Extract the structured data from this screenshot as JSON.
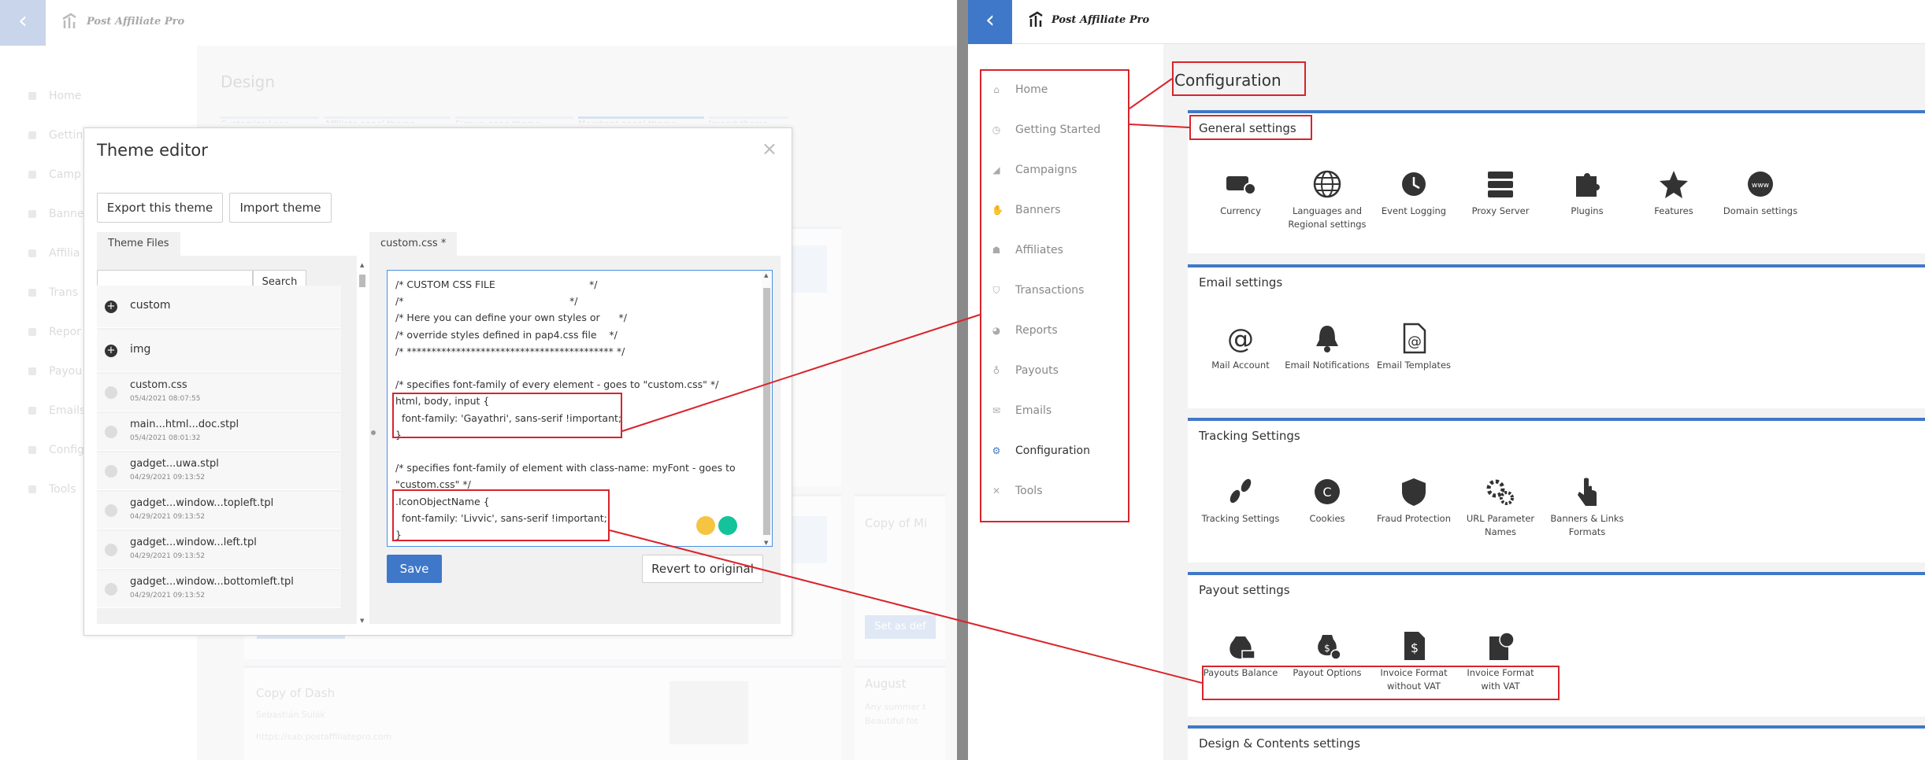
{
  "app": {
    "brand": "Post Affiliate Pro"
  },
  "left_screen": {
    "nav": [
      "Home",
      "Gettin",
      "Camp",
      "Banne",
      "Affilia",
      "Trans",
      "Repor",
      "Payou",
      "Emails",
      "Config",
      "Tools"
    ],
    "page_title": "Design",
    "tabs": [
      "Customize Logo",
      "Affiliate panel theme",
      "Signup page theme",
      "Merchant panel theme",
      "Import theme"
    ],
    "ghost": {
      "copy_of_dash": "Copy of Dash",
      "author": "Sebastián Sulák",
      "url": "https://sab.postaffiliatepro.com",
      "copy_of_mi": "Copy of Mi",
      "august": "August",
      "august_sub1": "Any summer t",
      "august_sub2": "Beautiful fot",
      "set_as_default": "Set as def"
    }
  },
  "theme_editor": {
    "title": "Theme editor",
    "close": "×",
    "export_button": "Export this theme",
    "import_button": "Import theme",
    "files_tab": "Theme Files",
    "editor_tab": "custom.css *",
    "search_button": "Search",
    "search_value": "",
    "folders": [
      "custom",
      "img"
    ],
    "files": [
      {
        "name": "custom.css",
        "date": "05/4/2021 08:07:55"
      },
      {
        "name": "main...html...doc.stpl",
        "date": "05/4/2021 08:01:32"
      },
      {
        "name": "gadget...uwa.stpl",
        "date": "04/29/2021 09:13:52"
      },
      {
        "name": "gadget...window...topleft.tpl",
        "date": "04/29/2021 09:13:52"
      },
      {
        "name": "gadget...window...left.tpl",
        "date": "04/29/2021 09:13:52"
      },
      {
        "name": "gadget...window...bottomleft.tpl",
        "date": "04/29/2021 09:13:52"
      }
    ],
    "code_lines": [
      "/* CUSTOM CSS FILE                              */",
      "/*                                                     */",
      "/* Here you can define your own styles or      */",
      "/* override styles defined in pap4.css file    */",
      "/* ****************************************** */",
      "",
      "/* specifies font-family of every element - goes to \"custom.css\" */",
      "html, body, input {",
      "  font-family: 'Gayathri', sans-serif !important;",
      "}",
      "",
      "/* specifies font-family of element with class-name: myFont - goes to",
      "\"custom.css\" */",
      ".IconObjectName {",
      "  font-family: 'Livvic', sans-serif !important;",
      "}"
    ],
    "save_button": "Save",
    "revert_button": "Revert to original"
  },
  "right_screen": {
    "nav": [
      {
        "label": "Home",
        "icon": "home-icon",
        "glyph": "⌂"
      },
      {
        "label": "Getting Started",
        "icon": "stopwatch-icon",
        "glyph": "◷"
      },
      {
        "label": "Campaigns",
        "icon": "megaphone-icon",
        "glyph": "◢"
      },
      {
        "label": "Banners",
        "icon": "hand-icon",
        "glyph": "✋"
      },
      {
        "label": "Affiliates",
        "icon": "users-icon",
        "glyph": "☗"
      },
      {
        "label": "Transactions",
        "icon": "basket-icon",
        "glyph": "⛉"
      },
      {
        "label": "Reports",
        "icon": "pie-chart-icon",
        "glyph": "◕"
      },
      {
        "label": "Payouts",
        "icon": "money-bag-icon",
        "glyph": "♁"
      },
      {
        "label": "Emails",
        "icon": "envelope-icon",
        "glyph": "✉"
      },
      {
        "label": "Configuration",
        "icon": "gear-icon",
        "glyph": "⚙"
      },
      {
        "label": "Tools",
        "icon": "tools-icon",
        "glyph": "✕"
      }
    ],
    "active_nav": "Configuration",
    "page_title": "Configuration",
    "sections": [
      {
        "title": "General settings",
        "items": [
          {
            "label": "Currency",
            "icon": "currency-icon"
          },
          {
            "label": "Languages and Regional settings",
            "icon": "globe-icon"
          },
          {
            "label": "Event Logging",
            "icon": "history-icon"
          },
          {
            "label": "Proxy Server",
            "icon": "server-icon"
          },
          {
            "label": "Plugins",
            "icon": "puzzle-icon"
          },
          {
            "label": "Features",
            "icon": "star-icon"
          },
          {
            "label": "Domain settings",
            "icon": "www-globe-icon"
          }
        ]
      },
      {
        "title": "Email settings",
        "items": [
          {
            "label": "Mail Account",
            "icon": "at-icon"
          },
          {
            "label": "Email Notifications",
            "icon": "bell-icon"
          },
          {
            "label": "Email Templates",
            "icon": "email-template-icon"
          }
        ]
      },
      {
        "title": "Tracking Settings",
        "items": [
          {
            "label": "Tracking Settings",
            "icon": "footprints-icon"
          },
          {
            "label": "Cookies",
            "icon": "cookie-icon"
          },
          {
            "label": "Fraud Protection",
            "icon": "shield-icon"
          },
          {
            "label": "URL Parameter Names",
            "icon": "gears-icon"
          },
          {
            "label": "Banners & Links Formats",
            "icon": "pointer-hand-icon"
          }
        ]
      },
      {
        "title": "Payout settings",
        "items": [
          {
            "label": "Payouts Balance",
            "icon": "balance-icon"
          },
          {
            "label": "Payout Options",
            "icon": "money-bag-gear-icon"
          },
          {
            "label": "Invoice Format without VAT",
            "icon": "invoice-dollar-icon"
          },
          {
            "label": "Invoice Format with VAT",
            "icon": "invoice-globe-icon"
          }
        ]
      },
      {
        "title": "Design & Contents settings",
        "items": []
      }
    ]
  },
  "colors": {
    "accent": "#3f78c8",
    "annotation": "#d9232b",
    "divider": "#8a8a8a"
  }
}
